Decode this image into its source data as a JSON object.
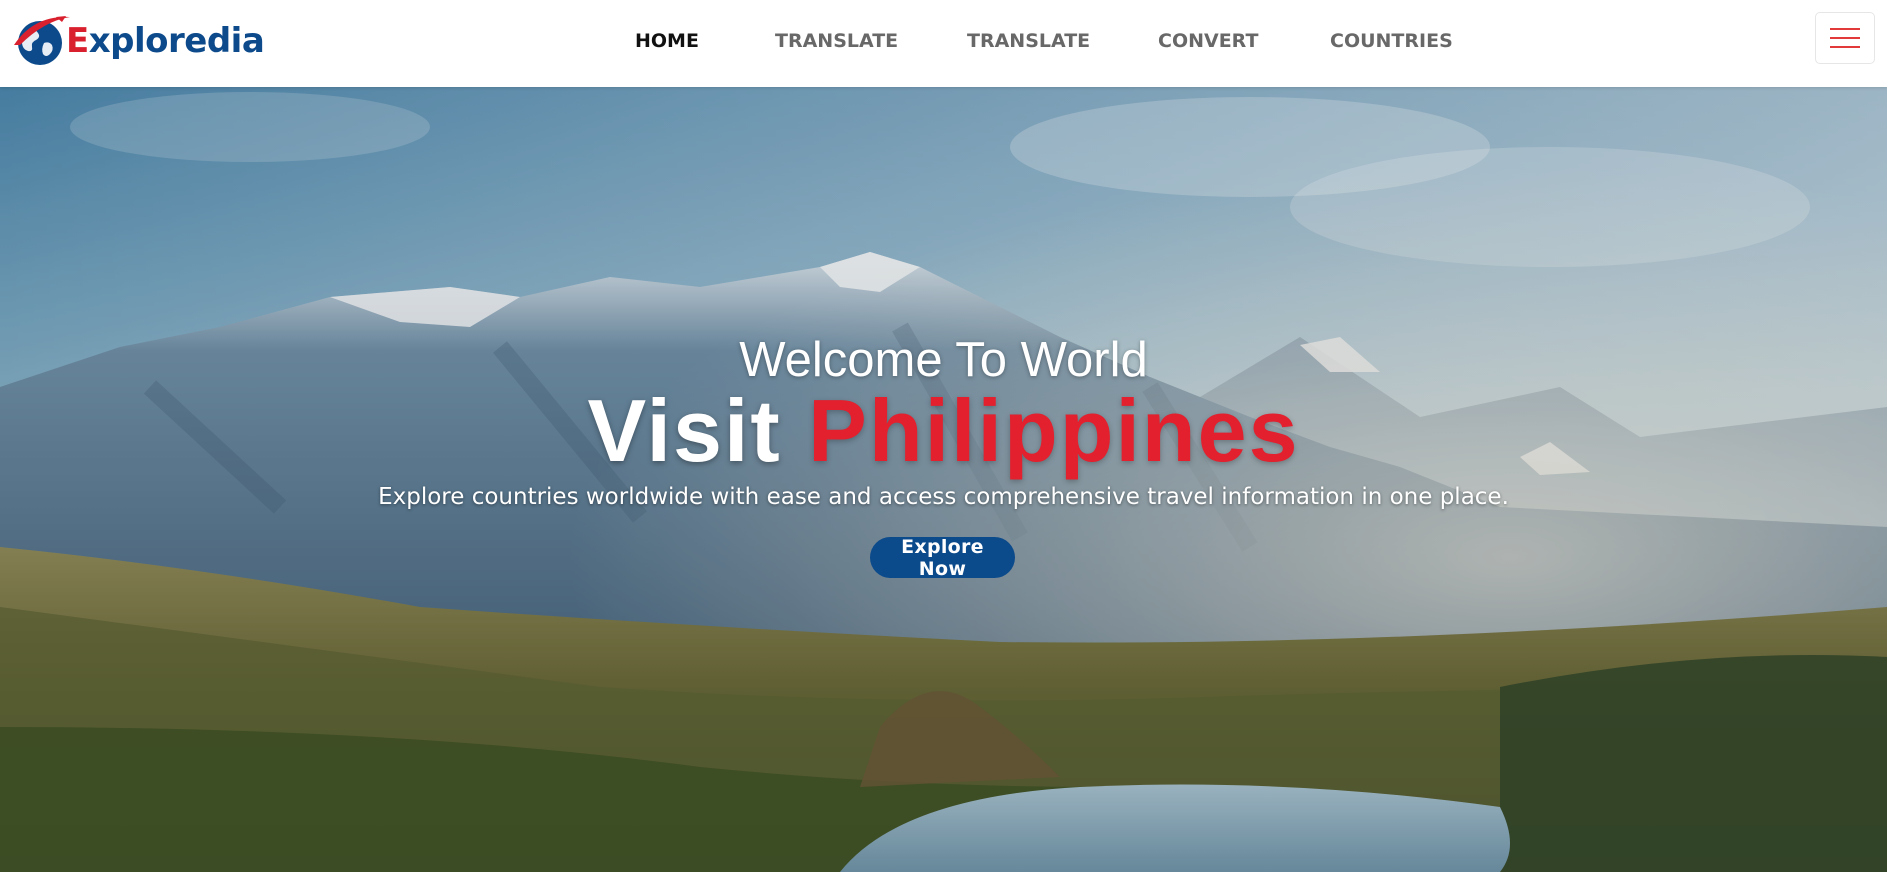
{
  "brand": {
    "name_first": "E",
    "name_rest": "xploredia",
    "logo_icon": "globe-with-airplane-icon"
  },
  "nav": {
    "links": [
      {
        "label": "HOME",
        "active": true
      },
      {
        "label": "TRANSLATE",
        "active": false
      },
      {
        "label": "TRANSLATE",
        "active": false
      },
      {
        "label": "CONVERT",
        "active": false
      },
      {
        "label": "COUNTRIES",
        "active": false
      }
    ],
    "menu_icon": "hamburger-menu-icon"
  },
  "hero": {
    "welcome": "Welcome To World",
    "title_prefix": "Visit",
    "title_country": "Philippines",
    "subtitle": "Explore countries worldwide with ease and access comprehensive travel information in one place.",
    "cta_label": "Explore Now"
  },
  "colors": {
    "brand_blue": "#0b4a8b",
    "brand_red": "#e2202e",
    "nav_text": "#686868",
    "nav_active": "#111111"
  }
}
